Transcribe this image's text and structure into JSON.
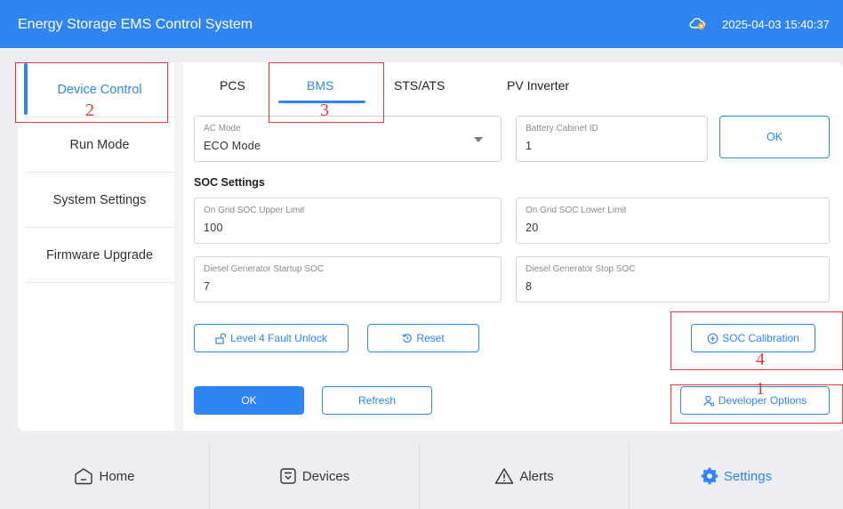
{
  "header": {
    "title": "Energy Storage EMS Control System",
    "datetime": "2025-04-03 15:40:37",
    "status_icon": "cloud-warning-icon"
  },
  "sidebar": {
    "items": [
      {
        "label": "Device Control",
        "active": true
      },
      {
        "label": "Run Mode"
      },
      {
        "label": "System Settings"
      },
      {
        "label": "Firmware Upgrade"
      }
    ]
  },
  "tabs": [
    {
      "label": "PCS"
    },
    {
      "label": "BMS",
      "active": true
    },
    {
      "label": "STS/ATS"
    },
    {
      "label": "PV Inverter"
    }
  ],
  "form": {
    "ac_mode": {
      "label": "AC Mode",
      "value": "ECO Mode"
    },
    "battery_cabinet_id": {
      "label": "Battery Cabinet ID",
      "value": "1"
    },
    "ok_label": "OK",
    "soc_section_title": "SOC Settings",
    "on_grid_upper": {
      "label": "On Grid SOC Upper Limit",
      "value": "100"
    },
    "on_grid_lower": {
      "label": "On Grid SOC Lower Limit",
      "value": "20"
    },
    "diesel_startup": {
      "label": "Diesel Generator Startup SOC",
      "value": "7"
    },
    "diesel_stop": {
      "label": "Diesel Generator Stop SOC",
      "value": "8"
    }
  },
  "actions": {
    "fault_unlock_label": "Level 4 Fault Unlock",
    "reset_label": "Reset",
    "soc_calibration_label": "SOC Calibration",
    "ok_label": "OK",
    "refresh_label": "Refresh",
    "developer_options_label": "Developer Options"
  },
  "annotations": [
    "1",
    "2",
    "3",
    "4"
  ],
  "bottom_nav": [
    {
      "label": "Home",
      "icon": "home-icon"
    },
    {
      "label": "Devices",
      "icon": "devices-icon"
    },
    {
      "label": "Alerts",
      "icon": "alert-icon"
    },
    {
      "label": "Settings",
      "icon": "settings-icon",
      "active": true
    }
  ],
  "colors": {
    "primary": "#2f86f2",
    "annotation": "#e53935"
  }
}
